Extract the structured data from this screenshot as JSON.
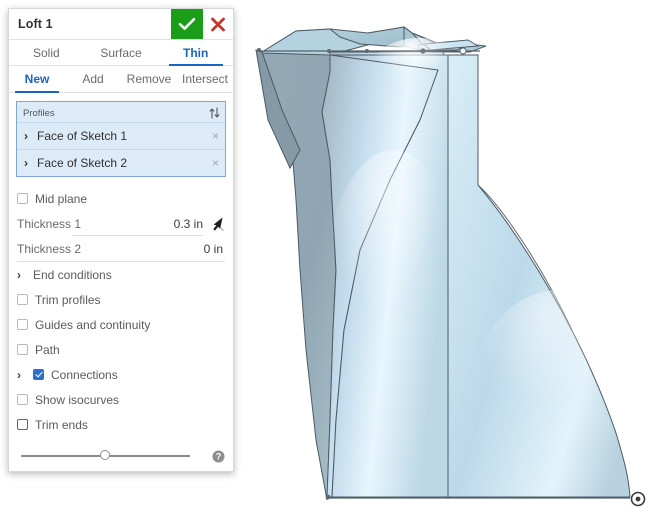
{
  "dialog": {
    "title": "Loft 1",
    "accept_icon": "check-icon",
    "cancel_icon": "close-icon",
    "type_tabs": [
      {
        "label": "Solid",
        "active": false
      },
      {
        "label": "Surface",
        "active": false
      },
      {
        "label": "Thin",
        "active": true
      }
    ],
    "operation_tabs": [
      {
        "label": "New",
        "active": true
      },
      {
        "label": "Add",
        "active": false
      },
      {
        "label": "Remove",
        "active": false
      },
      {
        "label": "Intersect",
        "active": false
      }
    ],
    "profiles": {
      "header": "Profiles",
      "sort_icon": "sort-updown-icon",
      "items": [
        {
          "name": "Face of Sketch 1",
          "chevron": "›",
          "remove": "×"
        },
        {
          "name": "Face of Sketch 2",
          "chevron": "›",
          "remove": "×"
        }
      ]
    },
    "mid_plane": {
      "label": "Mid plane",
      "checked": false
    },
    "thickness_1": {
      "label": "Thickness 1",
      "value": "0.3 in",
      "icon": "flip-direction-icon"
    },
    "thickness_2": {
      "label": "Thickness 2",
      "value": "0 in"
    },
    "end_conditions": {
      "label": "End conditions",
      "chevron": "›"
    },
    "trim_profiles": {
      "label": "Trim profiles",
      "checked": false
    },
    "guides_and_continuity": {
      "label": "Guides and continuity",
      "checked": false
    },
    "path": {
      "label": "Path",
      "checked": false
    },
    "connections": {
      "label": "Connections",
      "checked": true,
      "chevron": "›"
    },
    "show_isocurves": {
      "label": "Show isocurves",
      "checked": false
    },
    "trim_ends": {
      "label": "Trim ends",
      "checked": false,
      "focused": true
    },
    "footer": {
      "slider_value": "50",
      "help_icon": "help-icon"
    }
  },
  "viewport": {
    "origin_marker": "origin-icon",
    "model_name": "lofted-thin-solid"
  },
  "colors": {
    "accent_blue": "#1b63c4",
    "accept_green": "#1a9e1a",
    "cancel_red": "#c0392b",
    "selection_fill": "#ddebf8",
    "selection_border": "#7fa7d4",
    "face_light": "#cfe3ef",
    "face_dark": "#8fa4b0",
    "edge": "#4a5560"
  }
}
